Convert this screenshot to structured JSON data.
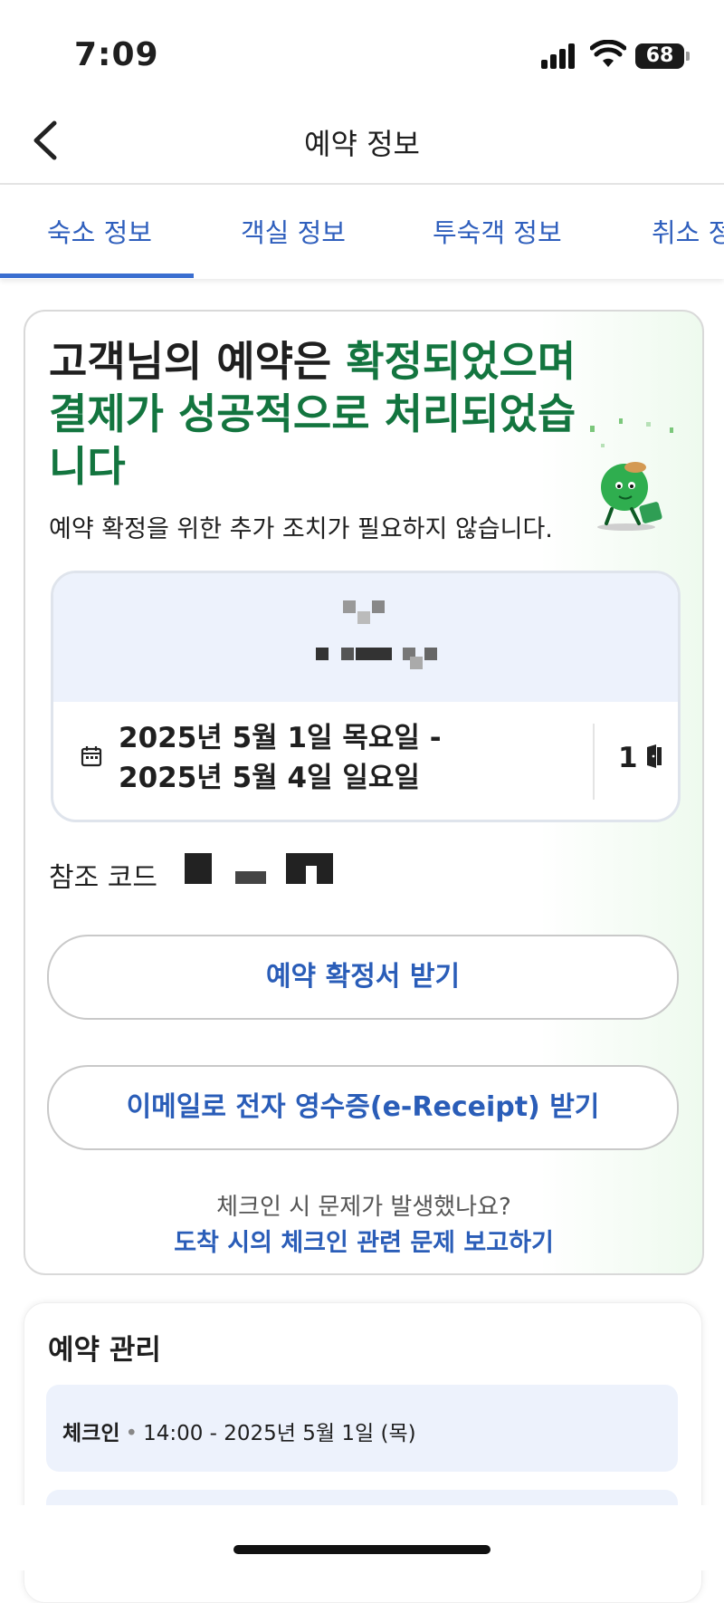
{
  "status": {
    "time": "7:09",
    "battery": "68"
  },
  "nav": {
    "title": "예약 정보"
  },
  "tabs": [
    "숙소 정보",
    "객실 정보",
    "투숙객 정보",
    "취소 정"
  ],
  "confirm": {
    "headline_part1": "고객님의 예약은 ",
    "headline_part2": "확정되었으며 결제가 성공적으로 처리되었습니다",
    "sub": "예약 확정을 위한 추가 조치가 필요하지 않습니다."
  },
  "stay": {
    "date_line1": "2025년 5월 1일 목요일 -",
    "date_line2": "2025년 5월 4일 일요일",
    "rooms": "1"
  },
  "reference": {
    "label": "참조 코드"
  },
  "buttons": {
    "voucher": "예약 확정서 받기",
    "receipt": "이메일로 전자 영수증(e-Receipt) 받기"
  },
  "help": {
    "question": "체크인 시 문제가 발생했나요?",
    "report": "도착 시의 체크인 관련 문제 보고하기"
  },
  "manage": {
    "title": "예약 관리",
    "checkin_label": "체크인",
    "checkin_value": "14:00 - 2025년 5월 1일 (목)"
  },
  "colors": {
    "accent_blue": "#2a5db8",
    "success_green": "#13753f",
    "tab_underline": "#3a6ed0"
  }
}
